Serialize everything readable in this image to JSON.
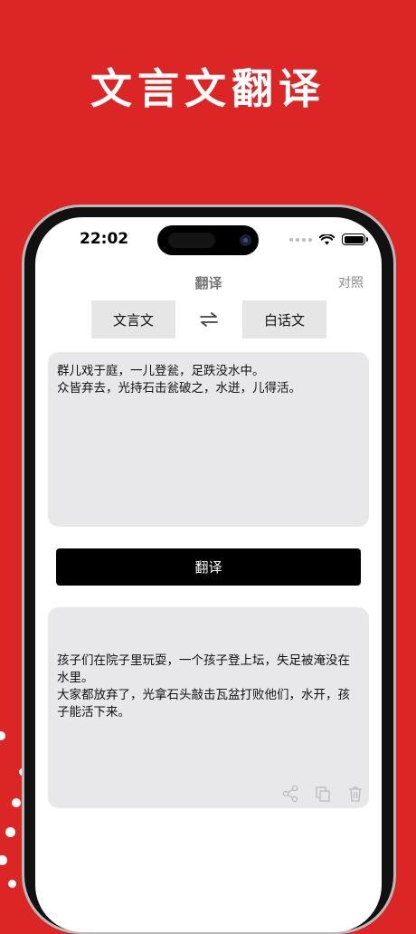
{
  "headline": "文言文翻译",
  "status_bar": {
    "time": "22:02"
  },
  "nav": {
    "title": "翻译",
    "right": "对照"
  },
  "languages": {
    "source": "文言文",
    "target": "白话文",
    "swap_icon": "swap-arrows-icon"
  },
  "input": {
    "text": "群儿戏于庭，一儿登瓮，足跌没水中。\n众皆弃去，光持石击瓮破之，水迸，儿得活。"
  },
  "action": {
    "translate_label": "翻译"
  },
  "output": {
    "text": "孩子们在院子里玩耍，一个孩子登上坛，失足被淹没在水里。\n大家都放弃了，光拿石头敲击瓦盆打败他们，水开，孩子能活下来。",
    "tools": [
      "share-icon",
      "copy-icon",
      "trash-icon"
    ]
  },
  "colors": {
    "background": "#dc2626",
    "button": "#000000",
    "box": "#e8e8ea"
  }
}
